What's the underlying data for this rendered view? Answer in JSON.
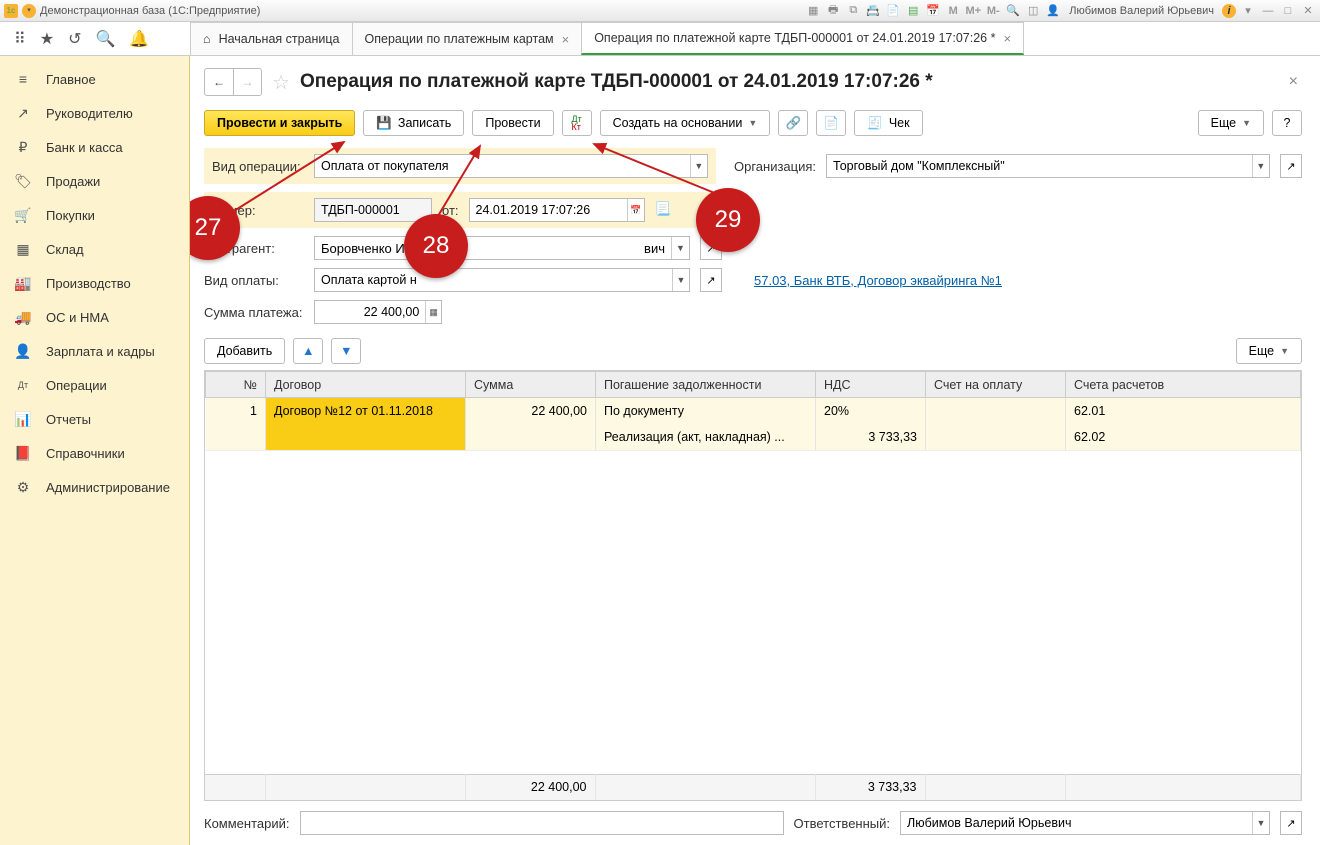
{
  "titlebar": {
    "app_title": "Демонстрационная база  (1С:Предприятие)",
    "m_labels": [
      "M",
      "M+",
      "M-"
    ],
    "user": "Любимов Валерий Юрьевич"
  },
  "tabs": {
    "home": "Начальная страница",
    "t1": "Операции по платежным картам",
    "t2": "Операция по платежной карте ТДБП-000001 от 24.01.2019 17:07:26 *"
  },
  "sidebar": {
    "items": [
      {
        "icon": "≡",
        "label": "Главное"
      },
      {
        "icon": "↗",
        "label": "Руководителю"
      },
      {
        "icon": "₽",
        "label": "Банк и касса"
      },
      {
        "icon": "🏷",
        "label": "Продажи"
      },
      {
        "icon": "🛒",
        "label": "Покупки"
      },
      {
        "icon": "▦",
        "label": "Склад"
      },
      {
        "icon": "🏭",
        "label": "Производство"
      },
      {
        "icon": "🚚",
        "label": "ОС и НМА"
      },
      {
        "icon": "👤",
        "label": "Зарплата и кадры"
      },
      {
        "icon": "Дт",
        "label": "Операции"
      },
      {
        "icon": "📊",
        "label": "Отчеты"
      },
      {
        "icon": "📕",
        "label": "Справочники"
      },
      {
        "icon": "⚙",
        "label": "Администрирование"
      }
    ]
  },
  "page": {
    "title": "Операция по платежной карте ТДБП-000001 от 24.01.2019 17:07:26 *",
    "actions": {
      "post_close": "Провести и закрыть",
      "save": "Записать",
      "post": "Провести",
      "create_based": "Создать на основании",
      "check": "Чек",
      "more": "Еще",
      "help": "?"
    },
    "form": {
      "op_type_lbl": "Вид операции:",
      "op_type": "Оплата от покупателя",
      "org_lbl": "Организация:",
      "org": "Торговый дом \"Комплексный\"",
      "num_lbl": "Номер:",
      "num": "ТДБП-000001",
      "from_lbl": "от:",
      "date": "24.01.2019 17:07:26",
      "agent_lbl": "Контрагент:",
      "agent": "Боровченко И",
      "agent_suffix": "вич",
      "paytype_lbl": "Вид оплаты:",
      "paytype": "Оплата картой н",
      "paylink": "57.03, Банк ВТБ, Договор эквайринга №1",
      "sum_lbl": "Сумма платежа:",
      "sum": "22 400,00"
    },
    "table_actions": {
      "add": "Добавить",
      "more": "Еще"
    },
    "table": {
      "cols": [
        "№",
        "Договор",
        "Сумма",
        "Погашение задолженности",
        "НДС",
        "Счет на оплату",
        "Счета расчетов"
      ],
      "rows": [
        {
          "n": "1",
          "contract": "Договор №12 от 01.11.2018",
          "sum": "22 400,00",
          "payoff": "По документу",
          "vat": "20%",
          "invoice": "",
          "acct": "62.01"
        },
        {
          "n": "",
          "contract": "",
          "sum": "",
          "payoff": "Реализация (акт, накладная) ...",
          "vat": "3 733,33",
          "invoice": "",
          "acct": "62.02"
        }
      ],
      "totals": {
        "sum": "22 400,00",
        "vat": "3 733,33"
      }
    },
    "foot": {
      "comment_lbl": "Комментарий:",
      "resp_lbl": "Ответственный:",
      "resp": "Любимов Валерий Юрьевич"
    }
  },
  "annotations": {
    "a27": "27",
    "a28": "28",
    "a29": "29"
  }
}
